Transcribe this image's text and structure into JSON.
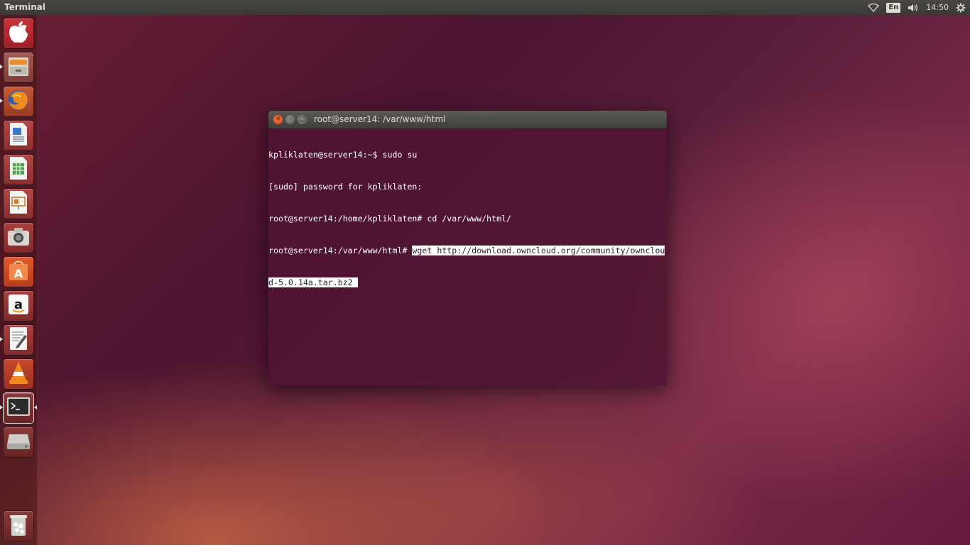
{
  "top_panel": {
    "app_title": "Terminal",
    "language": "En",
    "clock": "14:50",
    "icons": [
      "wifi-icon",
      "keyboard-layout-indicator",
      "volume-icon",
      "gear-icon"
    ]
  },
  "launcher": {
    "items": [
      {
        "name": "apple-icon",
        "color": "#b8262c"
      },
      {
        "name": "files-icon",
        "color": "#8a4a4a"
      },
      {
        "name": "firefox-icon",
        "color": "#b34a2a"
      },
      {
        "name": "libreoffice-writer-icon",
        "color": "#9b3a3a"
      },
      {
        "name": "libreoffice-calc-icon",
        "color": "#9b3a3a"
      },
      {
        "name": "libreoffice-impress-icon",
        "color": "#9b3a3a"
      },
      {
        "name": "camera-icon",
        "color": "#8f3434"
      },
      {
        "name": "software-center-icon",
        "color": "#c4432b"
      },
      {
        "name": "amazon-icon",
        "color": "#8f3434"
      },
      {
        "name": "text-editor-icon",
        "color": "#8f3434"
      },
      {
        "name": "vlc-icon",
        "color": "#b13a2a"
      },
      {
        "name": "terminal-icon",
        "color": "#7a2a2a"
      },
      {
        "name": "drive-icon",
        "color": "#7a2a2a"
      }
    ],
    "trash": {
      "name": "trash-icon"
    }
  },
  "terminal": {
    "title": "root@server14: /var/www/html",
    "lines": [
      {
        "text": "kpliklaten@server14:~$ sudo su",
        "highlight": ""
      },
      {
        "text": "[sudo] password for kpliklaten:",
        "highlight": ""
      },
      {
        "text": "root@server14:/home/kpliklaten# cd /var/www/html/",
        "highlight": ""
      },
      {
        "text": "root@server14:/var/www/html# ",
        "highlight": "wget http://download.owncloud.org/community/ownclou"
      },
      {
        "text": "",
        "highlight": "d-5.0.14a.tar.bz2 "
      }
    ]
  }
}
